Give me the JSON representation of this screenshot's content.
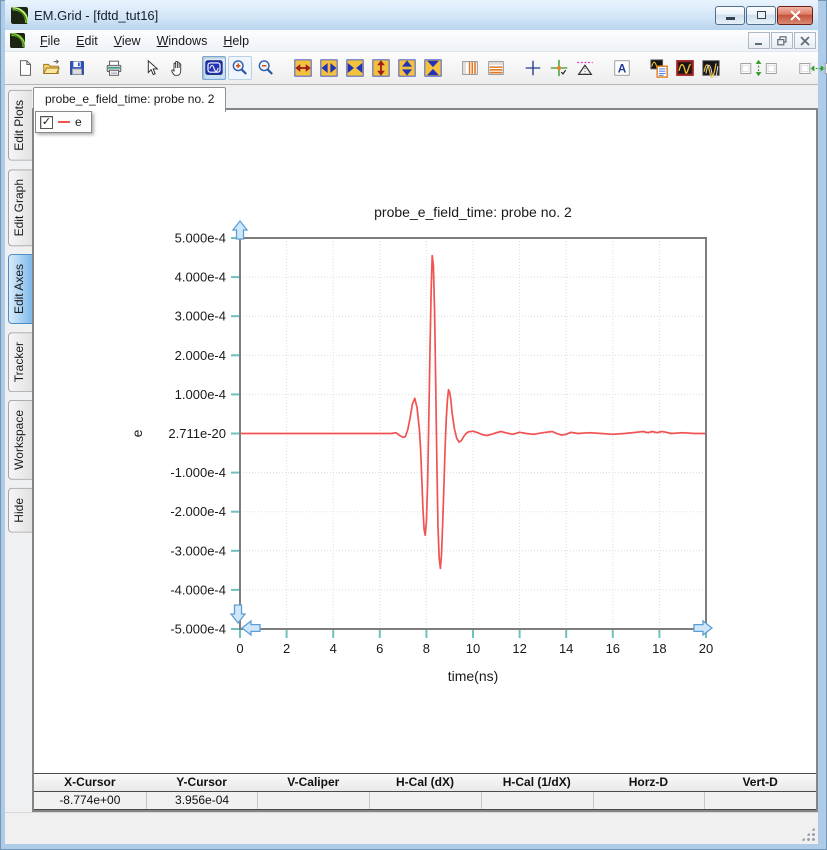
{
  "window": {
    "title": "EM.Grid - [fdtd_tut16]",
    "controls": [
      "minimize",
      "restore",
      "close"
    ],
    "child_controls": [
      "minimize",
      "restore",
      "close"
    ]
  },
  "menu": {
    "items": [
      "File",
      "Edit",
      "View",
      "Windows",
      "Help"
    ]
  },
  "toolbar": {
    "groups": [
      [
        "new-file-icon",
        "open-file-icon",
        "save-icon"
      ],
      [
        "print-icon"
      ],
      [
        "pointer-icon",
        "pan-icon"
      ],
      [
        "zoom-box-icon",
        "zoom-in-icon",
        "zoom-out-icon"
      ],
      [
        "stretch-x-icon",
        "expand-x-icon",
        "compress-x-icon",
        "stretch-y-icon",
        "expand-y-icon",
        "compress-y-icon"
      ],
      [
        "vertical-markers-icon",
        "horizontal-markers-icon"
      ],
      [
        "crosshair-icon",
        "tracker-icon",
        "caliper-icon"
      ],
      [
        "text-annotation-icon"
      ],
      [
        "plot-properties-icon",
        "plot-frame-icon",
        "plot-overlay-icon"
      ],
      [
        "autoscale-y-icon"
      ],
      [
        "autoscale-x-icon"
      ]
    ],
    "active_button": "zoom-box-icon",
    "hover_button": "zoom-in-icon"
  },
  "sidebar": {
    "tabs": [
      {
        "label": "Edit Plots",
        "active": false
      },
      {
        "label": "Edit Graph",
        "active": false
      },
      {
        "label": "Edit Axes",
        "active": true
      },
      {
        "label": "Tracker",
        "active": false
      },
      {
        "label": "Workspace",
        "active": false
      },
      {
        "label": "Hide",
        "active": false
      }
    ]
  },
  "plot_tab": {
    "label": "probe_e_field_time: probe no. 2"
  },
  "legend": {
    "checked": true,
    "check_glyph": "✓",
    "series_label": "e",
    "line_color": "#f25252"
  },
  "chart_data": {
    "type": "line",
    "title": "probe_e_field_time: probe no. 2",
    "xlabel": "time(ns)",
    "ylabel": "e",
    "xlim": [
      0,
      20
    ],
    "ylim": [
      -0.0005,
      0.0005
    ],
    "grid": true,
    "legend_position": "top-left",
    "xticks": {
      "values": [
        0,
        2,
        4,
        6,
        8,
        10,
        12,
        14,
        16,
        18,
        20
      ],
      "labels": [
        "0",
        "2",
        "4",
        "6",
        "8",
        "10",
        "12",
        "14",
        "16",
        "18",
        "20"
      ]
    },
    "yticks": {
      "values": [
        0.0005,
        0.0004,
        0.0003,
        0.0002,
        0.0001,
        0,
        -0.0001,
        -0.0002,
        -0.0003,
        -0.0004,
        -0.0005
      ],
      "labels": [
        "5.000e-4",
        "4.000e-4",
        "3.000e-4",
        "2.000e-4",
        "1.000e-4",
        "2.711e-20",
        "-1.000e-4",
        "-2.000e-4",
        "-3.000e-4",
        "-4.000e-4",
        "-5.000e-4"
      ]
    },
    "series": [
      {
        "name": "e",
        "color": "#f25252",
        "x": [
          0,
          6,
          6.5,
          6.7,
          6.85,
          7,
          7.1,
          7.2,
          7.3,
          7.4,
          7.5,
          7.6,
          7.7,
          7.75,
          7.8,
          7.85,
          7.9,
          7.95,
          8,
          8.05,
          8.1,
          8.15,
          8.2,
          8.25,
          8.3,
          8.35,
          8.4,
          8.45,
          8.5,
          8.55,
          8.6,
          8.65,
          8.7,
          8.75,
          8.8,
          8.85,
          8.9,
          8.95,
          9,
          9.05,
          9.1,
          9.2,
          9.3,
          9.4,
          9.5,
          9.6,
          9.7,
          9.8,
          10,
          10.2,
          10.4,
          10.6,
          10.8,
          11,
          11.2,
          11.4,
          11.7,
          12,
          12.3,
          12.6,
          13,
          13.4,
          13.6,
          13.8,
          14,
          14.2,
          14.5,
          15,
          15.5,
          16,
          16.5,
          17,
          17.3,
          17.5,
          17.7,
          17.9,
          18.1,
          18.3,
          18.5,
          19,
          19.5,
          20
        ],
        "y": [
          0,
          0,
          0,
          2e-06,
          -5e-06,
          -1e-05,
          -8e-06,
          1e-05,
          4e-05,
          7.5e-05,
          9e-05,
          6.5e-05,
          1e-05,
          -4e-05,
          -0.00011,
          -0.00019,
          -0.000245,
          -0.00026,
          -0.000225,
          -0.00013,
          2e-05,
          0.0002,
          0.00036,
          0.000455,
          0.00043,
          0.00031,
          0.00013,
          -8e-05,
          -0.00024,
          -0.00032,
          -0.000345,
          -0.00031,
          -0.00023,
          -0.000135,
          -4.5e-05,
          3.5e-05,
          8.5e-05,
          0.000112,
          0.000105,
          8.5e-05,
          5.5e-05,
          1.2e-05,
          -1.2e-05,
          -2.2e-05,
          -1.8e-05,
          -8e-06,
          0,
          4e-06,
          6e-06,
          2e-06,
          -3e-06,
          -5e-06,
          -2e-06,
          2e-06,
          5e-06,
          2e-06,
          -2e-06,
          3e-06,
          0,
          -2e-06,
          2e-06,
          5e-06,
          0,
          -4e-06,
          -2e-06,
          3e-06,
          0,
          2e-06,
          0,
          -2e-06,
          0,
          3e-06,
          5e-06,
          2e-06,
          5e-06,
          2e-06,
          5e-06,
          3e-06,
          0,
          2e-06,
          0,
          0
        ]
      }
    ]
  },
  "status_bar": {
    "columns": [
      {
        "label": "X-Cursor",
        "value": "-8.774e+00"
      },
      {
        "label": "Y-Cursor",
        "value": "3.956e-04"
      },
      {
        "label": "V-Caliper",
        "value": ""
      },
      {
        "label": "H-Cal (dX)",
        "value": ""
      },
      {
        "label": "H-Cal (1/dX)",
        "value": ""
      },
      {
        "label": "Horz-D",
        "value": ""
      },
      {
        "label": "Vert-D",
        "value": ""
      }
    ]
  },
  "colors": {
    "accent_border": "#aecbe8",
    "tick": "#6fc0c0",
    "grid": "#d8dde0",
    "axis_frame": "#7d7d7d",
    "series": "#f25252",
    "handle_fill": "#cfe7f9",
    "handle_stroke": "#5c9fd8",
    "active_tab": "#7db9ea"
  }
}
